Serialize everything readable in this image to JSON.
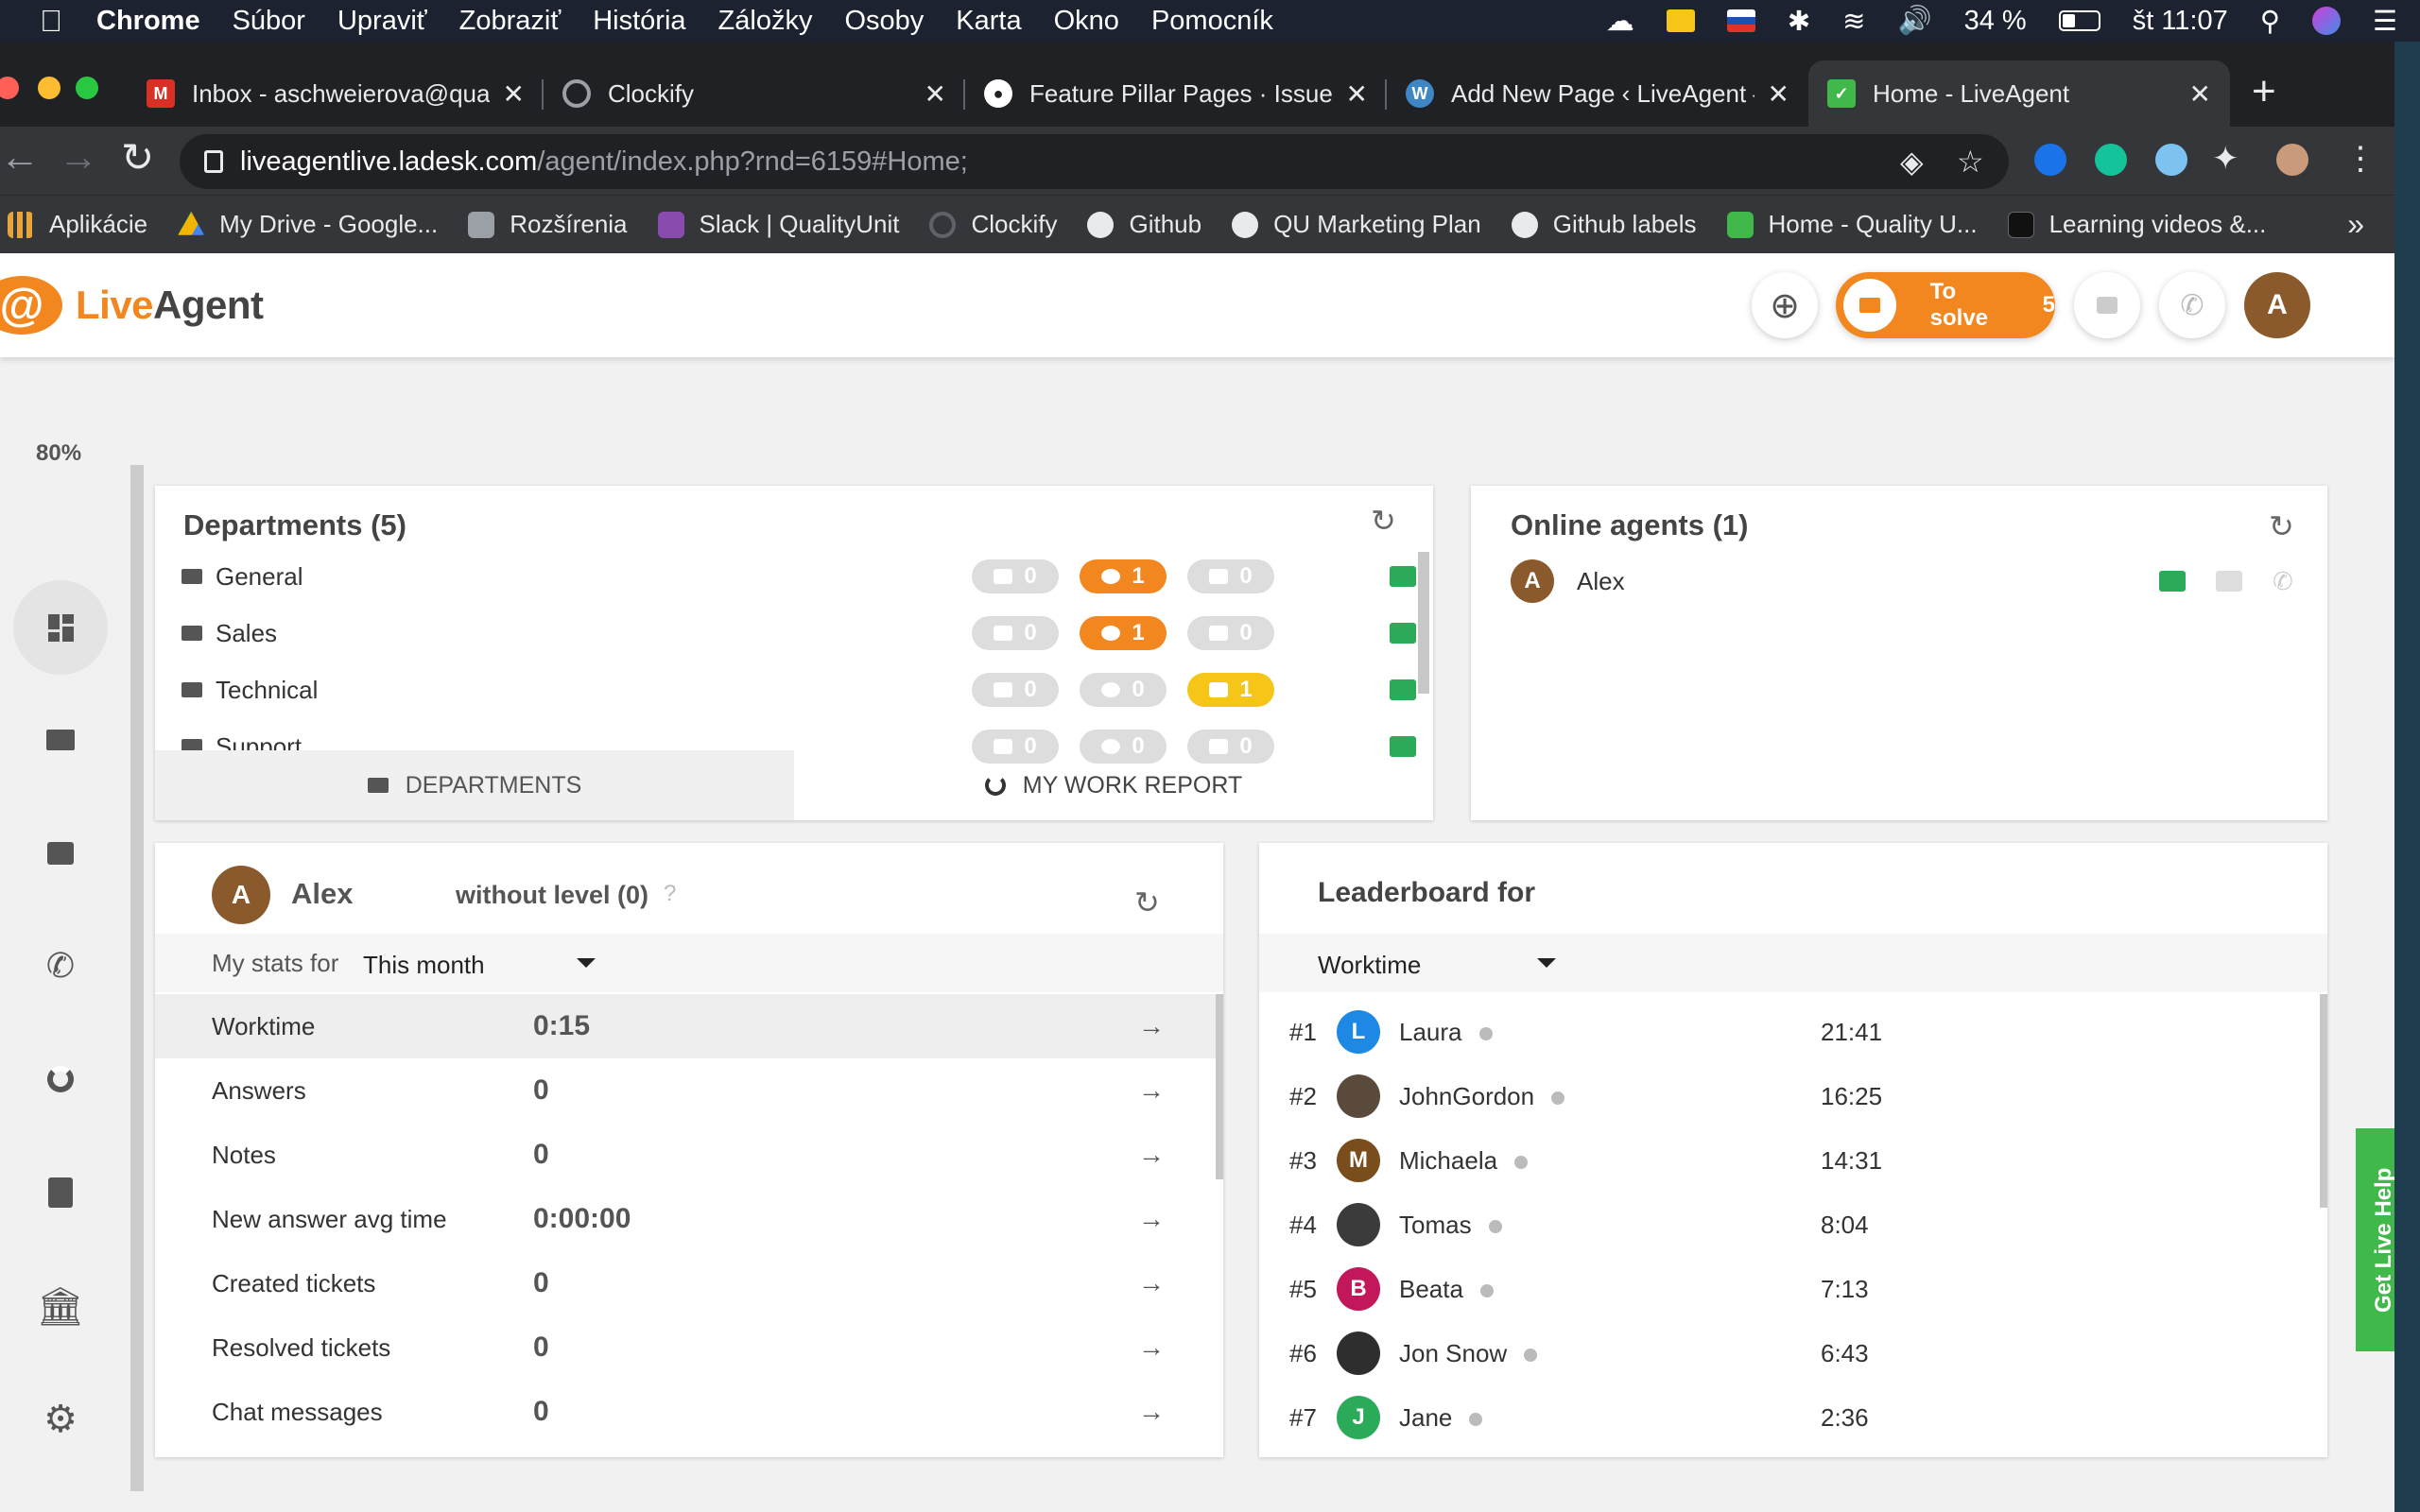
{
  "menubar": {
    "app": "Chrome",
    "items": [
      "Súbor",
      "Upraviť",
      "Zobraziť",
      "História",
      "Záložky",
      "Osoby",
      "Karta",
      "Okno",
      "Pomocník"
    ],
    "battery": "34 %",
    "clock": "št 11:07"
  },
  "tabs": [
    {
      "title": "Inbox - aschweierova@quali",
      "icon": "gmail-icon",
      "color": "#d93025"
    },
    {
      "title": "Clockify",
      "icon": "clockify-icon",
      "color": "#5f6368"
    },
    {
      "title": "Feature Pillar Pages · Issue #",
      "icon": "github-icon",
      "color": "#ffffff"
    },
    {
      "title": "Add New Page ‹ LiveAgent —",
      "icon": "wordpress-icon",
      "color": "#3e86c4"
    },
    {
      "title": "Home - LiveAgent",
      "icon": "liveagent-icon",
      "color": "#41b94a",
      "active": true
    }
  ],
  "address": {
    "host": "liveagentlive.ladesk.com",
    "path": "/agent/index.php?rnd=6159#Home;"
  },
  "bookmarks": [
    {
      "label": "Aplikácie",
      "icon": "apps-icon",
      "color": "#e9a33b"
    },
    {
      "label": "My Drive - Google...",
      "icon": "drive-icon",
      "color": "#f4b400"
    },
    {
      "label": "Rozšírenia",
      "icon": "puzzle-icon",
      "color": "#9aa0a6"
    },
    {
      "label": "Slack | QualityUnit",
      "icon": "slack-icon",
      "color": "#8a4baf"
    },
    {
      "label": "Clockify",
      "icon": "clockify-icon",
      "color": "#5f6368"
    },
    {
      "label": "Github",
      "icon": "github-icon",
      "color": "#e8eaed"
    },
    {
      "label": "QU Marketing Plan",
      "icon": "github-icon",
      "color": "#e8eaed"
    },
    {
      "label": "Github labels",
      "icon": "github-icon",
      "color": "#e8eaed"
    },
    {
      "label": "Home - Quality U...",
      "icon": "liveagent-icon",
      "color": "#41b94a"
    },
    {
      "label": "Learning videos &...",
      "icon": "book-icon",
      "color": "#111111"
    }
  ],
  "bookmarks_more": "»",
  "header": {
    "logo_live": "Live",
    "logo_agent": "Agent",
    "to_solve_label": "To solve",
    "to_solve_count": "5",
    "avatar_initial": "A"
  },
  "sidebar": {
    "zoom": "80%"
  },
  "departments": {
    "title": "Departments (5)",
    "rows": [
      {
        "name": "General",
        "chats": "0",
        "calls": "1",
        "tickets": "0",
        "calls_state": "orange",
        "tickets_state": "grey"
      },
      {
        "name": "Sales",
        "chats": "0",
        "calls": "1",
        "tickets": "0",
        "calls_state": "orange",
        "tickets_state": "grey"
      },
      {
        "name": "Technical",
        "chats": "0",
        "calls": "0",
        "tickets": "1",
        "calls_state": "grey",
        "tickets_state": "yellow"
      },
      {
        "name": "Support",
        "chats": "0",
        "calls": "0",
        "tickets": "0",
        "calls_state": "grey",
        "tickets_state": "grey"
      }
    ],
    "tab_departments": "DEPARTMENTS",
    "tab_report": "MY WORK REPORT"
  },
  "online_agents": {
    "title": "Online agents (1)",
    "agents": [
      {
        "initial": "A",
        "name": "Alex"
      }
    ]
  },
  "my_stats": {
    "avatar_initial": "A",
    "name": "Alex",
    "level": "without level (0)",
    "help": "?",
    "period_label": "My stats for",
    "period_value": "This month",
    "rows": [
      {
        "label": "Worktime",
        "value": "0:15"
      },
      {
        "label": "Answers",
        "value": "0"
      },
      {
        "label": "Notes",
        "value": "0"
      },
      {
        "label": "New answer avg time",
        "value": "0:00:00"
      },
      {
        "label": "Created tickets",
        "value": "0"
      },
      {
        "label": "Resolved tickets",
        "value": "0"
      },
      {
        "label": "Chat messages",
        "value": "0"
      }
    ]
  },
  "leaderboard": {
    "title": "Leaderboard for",
    "metric": "Worktime",
    "rows": [
      {
        "rank": "#1",
        "initial": "L",
        "name": "Laura",
        "time": "21:41",
        "color": "#1e88e5"
      },
      {
        "rank": "#2",
        "initial": "",
        "name": "JohnGordon",
        "time": "16:25",
        "color": "#5a4a3c"
      },
      {
        "rank": "#3",
        "initial": "M",
        "name": "Michaela",
        "time": "14:31",
        "color": "#7a4e1c"
      },
      {
        "rank": "#4",
        "initial": "",
        "name": "Tomas",
        "time": "8:04",
        "color": "#3b3b3b"
      },
      {
        "rank": "#5",
        "initial": "B",
        "name": "Beata",
        "time": "7:13",
        "color": "#c2185b"
      },
      {
        "rank": "#6",
        "initial": "",
        "name": "Jon Snow",
        "time": "6:43",
        "color": "#2e2e2e"
      },
      {
        "rank": "#7",
        "initial": "J",
        "name": "Jane",
        "time": "2:36",
        "color": "#2bab5a"
      }
    ]
  },
  "live_help": "Get Live Help"
}
